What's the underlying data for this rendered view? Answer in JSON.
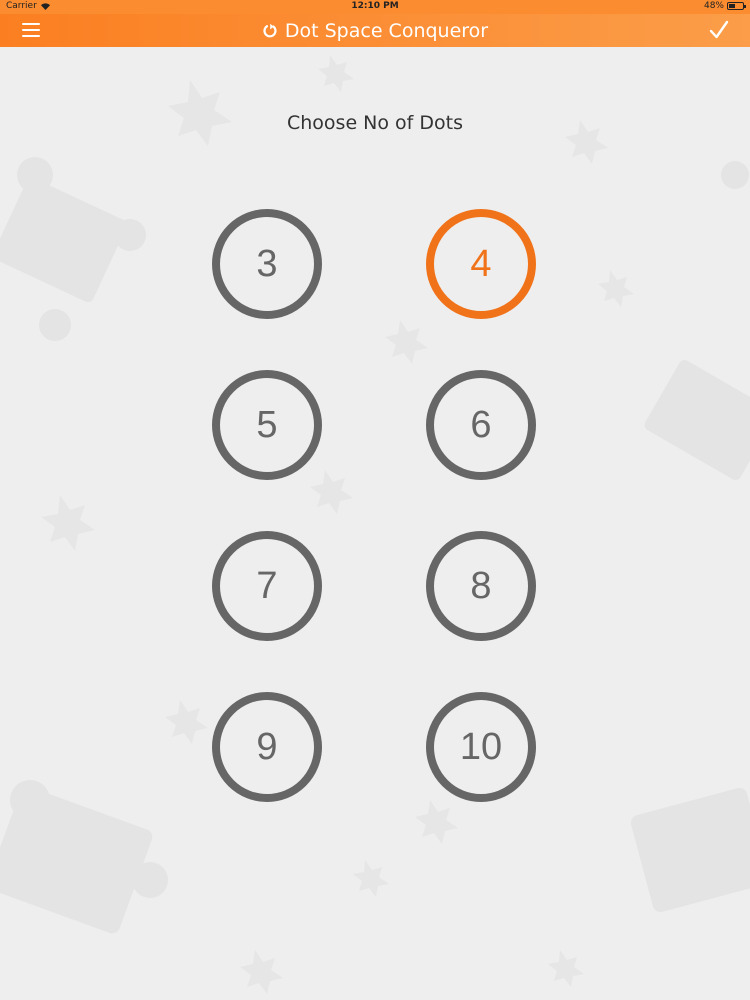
{
  "status_bar": {
    "carrier": "Carrier",
    "time": "12:10 PM",
    "battery_percent": "48%",
    "battery_level": 0.48
  },
  "nav_bar": {
    "title": "Dot Space Conqueror",
    "left_icon": "hamburger-menu-icon",
    "title_icon": "refresh-icon",
    "right_icon": "checkmark-icon"
  },
  "heading": "Choose No of Dots",
  "dot_options": [
    {
      "label": "3",
      "selected": false
    },
    {
      "label": "4",
      "selected": true
    },
    {
      "label": "5",
      "selected": false
    },
    {
      "label": "6",
      "selected": false
    },
    {
      "label": "7",
      "selected": false
    },
    {
      "label": "8",
      "selected": false
    },
    {
      "label": "9",
      "selected": false
    },
    {
      "label": "10",
      "selected": false
    }
  ],
  "colors": {
    "accent": "#f0731a",
    "nav_bar": "#fb8a30",
    "ring": "#666666",
    "background": "#eeeeee"
  }
}
